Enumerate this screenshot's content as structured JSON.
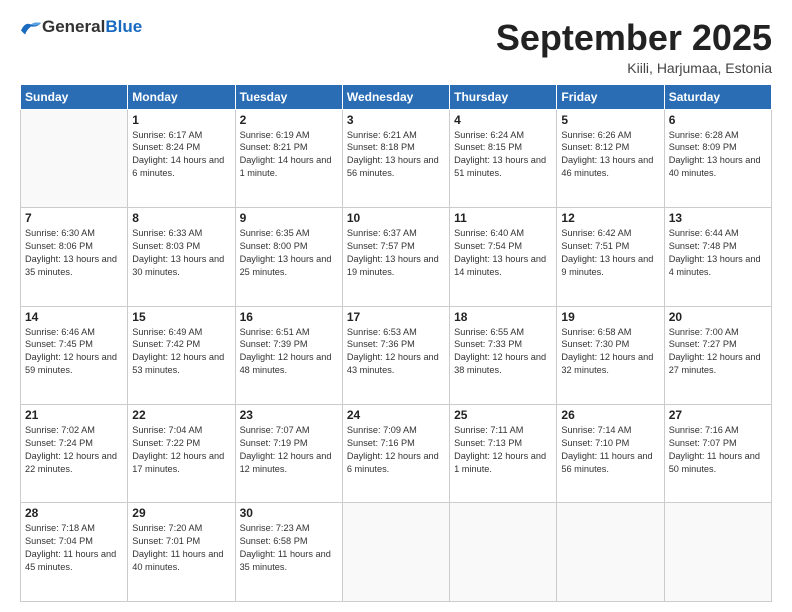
{
  "header": {
    "logo_general": "General",
    "logo_blue": "Blue",
    "title": "September 2025",
    "location": "Kiili, Harjumaa, Estonia"
  },
  "weekdays": [
    "Sunday",
    "Monday",
    "Tuesday",
    "Wednesday",
    "Thursday",
    "Friday",
    "Saturday"
  ],
  "weeks": [
    [
      {
        "day": "",
        "sunrise": "",
        "sunset": "",
        "daylight": ""
      },
      {
        "day": "1",
        "sunrise": "Sunrise: 6:17 AM",
        "sunset": "Sunset: 8:24 PM",
        "daylight": "Daylight: 14 hours and 6 minutes."
      },
      {
        "day": "2",
        "sunrise": "Sunrise: 6:19 AM",
        "sunset": "Sunset: 8:21 PM",
        "daylight": "Daylight: 14 hours and 1 minute."
      },
      {
        "day": "3",
        "sunrise": "Sunrise: 6:21 AM",
        "sunset": "Sunset: 8:18 PM",
        "daylight": "Daylight: 13 hours and 56 minutes."
      },
      {
        "day": "4",
        "sunrise": "Sunrise: 6:24 AM",
        "sunset": "Sunset: 8:15 PM",
        "daylight": "Daylight: 13 hours and 51 minutes."
      },
      {
        "day": "5",
        "sunrise": "Sunrise: 6:26 AM",
        "sunset": "Sunset: 8:12 PM",
        "daylight": "Daylight: 13 hours and 46 minutes."
      },
      {
        "day": "6",
        "sunrise": "Sunrise: 6:28 AM",
        "sunset": "Sunset: 8:09 PM",
        "daylight": "Daylight: 13 hours and 40 minutes."
      }
    ],
    [
      {
        "day": "7",
        "sunrise": "Sunrise: 6:30 AM",
        "sunset": "Sunset: 8:06 PM",
        "daylight": "Daylight: 13 hours and 35 minutes."
      },
      {
        "day": "8",
        "sunrise": "Sunrise: 6:33 AM",
        "sunset": "Sunset: 8:03 PM",
        "daylight": "Daylight: 13 hours and 30 minutes."
      },
      {
        "day": "9",
        "sunrise": "Sunrise: 6:35 AM",
        "sunset": "Sunset: 8:00 PM",
        "daylight": "Daylight: 13 hours and 25 minutes."
      },
      {
        "day": "10",
        "sunrise": "Sunrise: 6:37 AM",
        "sunset": "Sunset: 7:57 PM",
        "daylight": "Daylight: 13 hours and 19 minutes."
      },
      {
        "day": "11",
        "sunrise": "Sunrise: 6:40 AM",
        "sunset": "Sunset: 7:54 PM",
        "daylight": "Daylight: 13 hours and 14 minutes."
      },
      {
        "day": "12",
        "sunrise": "Sunrise: 6:42 AM",
        "sunset": "Sunset: 7:51 PM",
        "daylight": "Daylight: 13 hours and 9 minutes."
      },
      {
        "day": "13",
        "sunrise": "Sunrise: 6:44 AM",
        "sunset": "Sunset: 7:48 PM",
        "daylight": "Daylight: 13 hours and 4 minutes."
      }
    ],
    [
      {
        "day": "14",
        "sunrise": "Sunrise: 6:46 AM",
        "sunset": "Sunset: 7:45 PM",
        "daylight": "Daylight: 12 hours and 59 minutes."
      },
      {
        "day": "15",
        "sunrise": "Sunrise: 6:49 AM",
        "sunset": "Sunset: 7:42 PM",
        "daylight": "Daylight: 12 hours and 53 minutes."
      },
      {
        "day": "16",
        "sunrise": "Sunrise: 6:51 AM",
        "sunset": "Sunset: 7:39 PM",
        "daylight": "Daylight: 12 hours and 48 minutes."
      },
      {
        "day": "17",
        "sunrise": "Sunrise: 6:53 AM",
        "sunset": "Sunset: 7:36 PM",
        "daylight": "Daylight: 12 hours and 43 minutes."
      },
      {
        "day": "18",
        "sunrise": "Sunrise: 6:55 AM",
        "sunset": "Sunset: 7:33 PM",
        "daylight": "Daylight: 12 hours and 38 minutes."
      },
      {
        "day": "19",
        "sunrise": "Sunrise: 6:58 AM",
        "sunset": "Sunset: 7:30 PM",
        "daylight": "Daylight: 12 hours and 32 minutes."
      },
      {
        "day": "20",
        "sunrise": "Sunrise: 7:00 AM",
        "sunset": "Sunset: 7:27 PM",
        "daylight": "Daylight: 12 hours and 27 minutes."
      }
    ],
    [
      {
        "day": "21",
        "sunrise": "Sunrise: 7:02 AM",
        "sunset": "Sunset: 7:24 PM",
        "daylight": "Daylight: 12 hours and 22 minutes."
      },
      {
        "day": "22",
        "sunrise": "Sunrise: 7:04 AM",
        "sunset": "Sunset: 7:22 PM",
        "daylight": "Daylight: 12 hours and 17 minutes."
      },
      {
        "day": "23",
        "sunrise": "Sunrise: 7:07 AM",
        "sunset": "Sunset: 7:19 PM",
        "daylight": "Daylight: 12 hours and 12 minutes."
      },
      {
        "day": "24",
        "sunrise": "Sunrise: 7:09 AM",
        "sunset": "Sunset: 7:16 PM",
        "daylight": "Daylight: 12 hours and 6 minutes."
      },
      {
        "day": "25",
        "sunrise": "Sunrise: 7:11 AM",
        "sunset": "Sunset: 7:13 PM",
        "daylight": "Daylight: 12 hours and 1 minute."
      },
      {
        "day": "26",
        "sunrise": "Sunrise: 7:14 AM",
        "sunset": "Sunset: 7:10 PM",
        "daylight": "Daylight: 11 hours and 56 minutes."
      },
      {
        "day": "27",
        "sunrise": "Sunrise: 7:16 AM",
        "sunset": "Sunset: 7:07 PM",
        "daylight": "Daylight: 11 hours and 50 minutes."
      }
    ],
    [
      {
        "day": "28",
        "sunrise": "Sunrise: 7:18 AM",
        "sunset": "Sunset: 7:04 PM",
        "daylight": "Daylight: 11 hours and 45 minutes."
      },
      {
        "day": "29",
        "sunrise": "Sunrise: 7:20 AM",
        "sunset": "Sunset: 7:01 PM",
        "daylight": "Daylight: 11 hours and 40 minutes."
      },
      {
        "day": "30",
        "sunrise": "Sunrise: 7:23 AM",
        "sunset": "Sunset: 6:58 PM",
        "daylight": "Daylight: 11 hours and 35 minutes."
      },
      {
        "day": "",
        "sunrise": "",
        "sunset": "",
        "daylight": ""
      },
      {
        "day": "",
        "sunrise": "",
        "sunset": "",
        "daylight": ""
      },
      {
        "day": "",
        "sunrise": "",
        "sunset": "",
        "daylight": ""
      },
      {
        "day": "",
        "sunrise": "",
        "sunset": "",
        "daylight": ""
      }
    ]
  ]
}
